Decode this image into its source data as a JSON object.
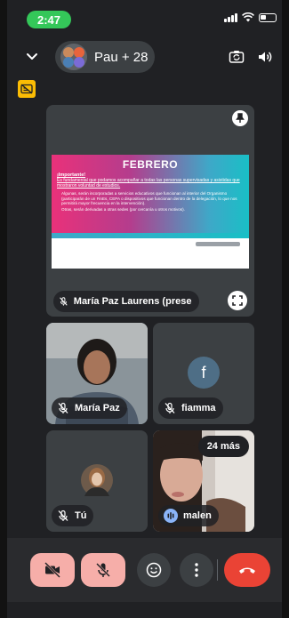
{
  "status_bar": {
    "time": "2:47"
  },
  "header": {
    "call_title": "Pau + 28"
  },
  "presentation": {
    "slide": {
      "title": "FEBRERO",
      "important": "¡Importante!",
      "intro": "Es fundamental que podamos acompañar a todas las personas supervisadas y asistidas que mostraron voluntad de estudios.",
      "bullets": [
        "Algunas, serán incorporadas a servicios educativos que funcionan al interior del Organismo (participarán de un FinEs, CEPA o dispositivos que funcionan dentro de la delegación, lo que nos permitirá mayor frecuencia en la intervención).",
        "Otras, serán derivadas a otras sedes (por cercanía u otros motivos)."
      ]
    },
    "presenter_label": "María Paz Laurens (presentando)"
  },
  "participants": [
    {
      "name": "María Paz",
      "muted": true
    },
    {
      "name": "fiamma",
      "initial": "f",
      "muted": true
    },
    {
      "name": "Tú",
      "muted": true
    },
    {
      "name": "malen",
      "speaking": true
    }
  ],
  "more_participants": "24 más",
  "colors": {
    "background": "#202124",
    "tile": "#3c4043",
    "control_pink": "#f6aea9",
    "end_call": "#ea4335",
    "status_time": "#34c759",
    "badge": "#fbbc04"
  }
}
